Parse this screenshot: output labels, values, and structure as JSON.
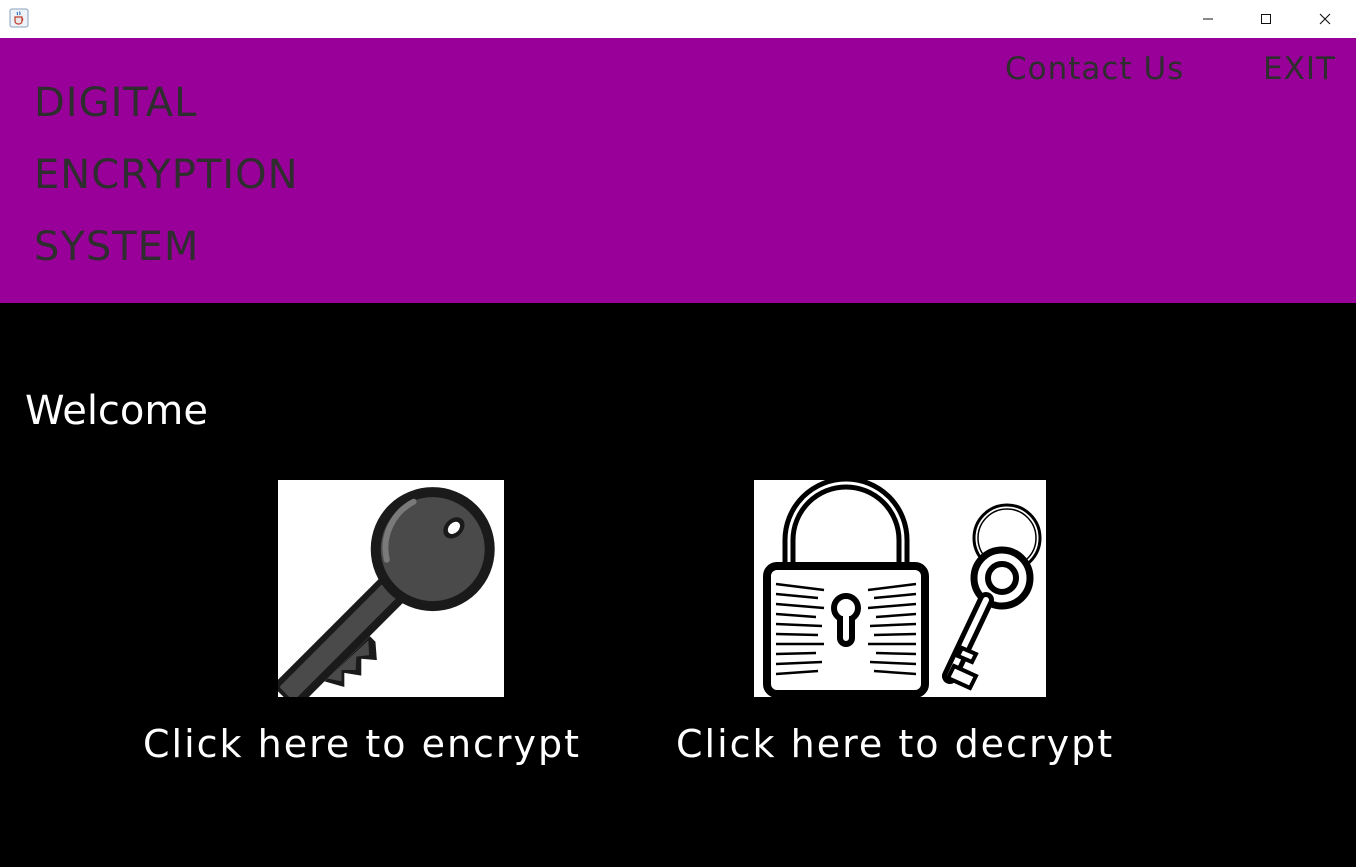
{
  "window": {
    "icon": "java-cup-icon",
    "controls": {
      "minimize": "minimize-icon",
      "maximize": "maximize-icon",
      "close": "close-icon"
    }
  },
  "header": {
    "background": "#990099",
    "text_color": "#2e2e2e",
    "brand_lines": [
      "DIGITAL",
      "ENCRYPTION",
      "SYSTEM"
    ],
    "nav": {
      "contact_label": "Contact Us",
      "exit_label": "EXIT"
    }
  },
  "main": {
    "background": "#000000",
    "welcome": "Welcome",
    "encrypt": {
      "icon": "key-icon",
      "label": "Click here to encrypt"
    },
    "decrypt": {
      "icon": "padlock-key-icon",
      "label": "Click here to decrypt"
    }
  }
}
